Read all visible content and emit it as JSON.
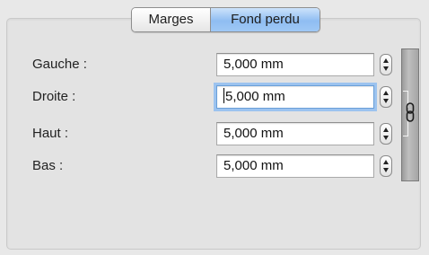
{
  "tabs": {
    "items": [
      {
        "label": "Marges",
        "active": false
      },
      {
        "label": "Fond perdu",
        "active": true
      }
    ]
  },
  "fields": [
    {
      "label": "Gauche :",
      "value": "5,000 mm",
      "focused": false
    },
    {
      "label": "Droite :",
      "value": "5,000 mm",
      "focused": true
    },
    {
      "label": "Haut :",
      "value": "5,000 mm",
      "focused": false
    },
    {
      "label": "Bas :",
      "value": "5,000 mm",
      "focused": false
    }
  ],
  "icons": {
    "stepper": "stepper-arrows-icon",
    "link": "chain-link-icon"
  },
  "colors": {
    "active_tab": "#9fc8f5",
    "focus_ring": "#9cc3ef",
    "chain_bar": "#a9a9a9"
  }
}
